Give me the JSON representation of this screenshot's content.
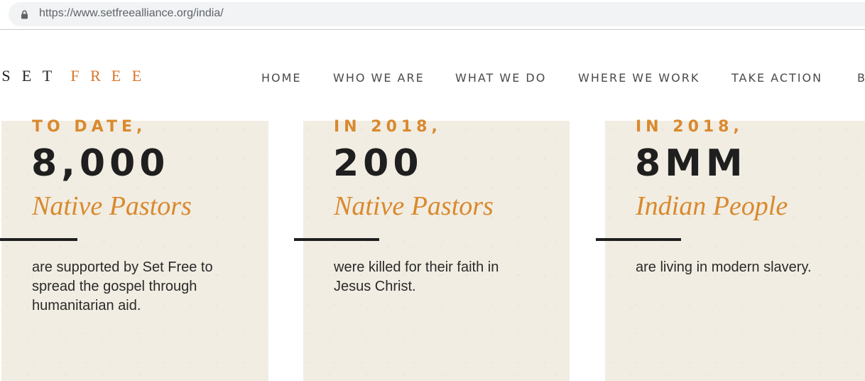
{
  "browser": {
    "url_host": "https://www.setfreealliance.org",
    "url_path": "/india/"
  },
  "logo": {
    "letters_dark": [
      "S",
      "E",
      "T"
    ],
    "letters_orange": [
      "F",
      "R",
      "E",
      "E"
    ]
  },
  "nav": {
    "items": [
      "HOME",
      "WHO WE ARE",
      "WHAT WE DO",
      "WHERE WE WORK",
      "TAKE ACTION",
      "B"
    ]
  },
  "stats": [
    {
      "eyebrow": "TO DATE,",
      "number": "8,000",
      "subject": "Native Pastors",
      "description": "are supported by Set Free to spread the gospel through humanitarian aid."
    },
    {
      "eyebrow": "IN 2018,",
      "number": "200",
      "subject": "Native Pastors",
      "description": "were killed for their faith in Jesus Christ."
    },
    {
      "eyebrow": "IN 2018,",
      "number": "8MM",
      "subject": "Indian People",
      "description": "are living in modern slavery."
    }
  ],
  "colors": {
    "accent": "#d9892e",
    "card_bg": "#f1ede2",
    "text_dark": "#1f1f1f"
  },
  "icons": {
    "lock": "lock-icon"
  }
}
